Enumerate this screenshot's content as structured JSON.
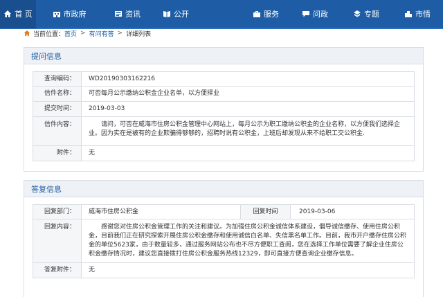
{
  "nav": {
    "items": [
      {
        "label": "首 页",
        "icon": "home-icon",
        "active": true
      },
      {
        "label": "市政府",
        "icon": "building-icon"
      },
      {
        "label": "资讯",
        "icon": "news-icon"
      },
      {
        "label": "公开",
        "icon": "book-icon"
      },
      {
        "label": "",
        "icon": "blank"
      },
      {
        "label": "服务",
        "icon": "service-icon"
      },
      {
        "label": "问政",
        "icon": "chat-icon"
      },
      {
        "label": "专题",
        "icon": "topic-icon"
      },
      {
        "label": "市情",
        "icon": "city-icon"
      }
    ]
  },
  "breadcrumb": {
    "prefix": "当前位置：",
    "items": [
      "首页",
      "有问有答",
      "详细列表"
    ],
    "sep": ">"
  },
  "question": {
    "title": "提问信息",
    "rows": [
      {
        "key": "查询编码：",
        "value": "WD20190303162216"
      },
      {
        "key": "信件名称：",
        "value": "可否每月公示缴纳公积金企业名单，以方便择业"
      },
      {
        "key": "提交时间：",
        "value": "2019-03-03"
      },
      {
        "key": "信件内容：",
        "value": "请问，可否在威海市住房公积金管理中心网站上，每月公示为职工缴纳公积金的企业名称，以方便我们选择企业。因为实在是被有的企业欺骗得够够的，招聘时说有公积金，上班后却发现从来不给职工交公积金."
      },
      {
        "key": "附件：",
        "value": "无"
      }
    ]
  },
  "answer": {
    "title": "答复信息",
    "dept_key": "回复部门：",
    "dept_value": "威海市住房公积金",
    "time_key": "回复时间",
    "time_value": "2019-03-06",
    "content_key": "回复内容：",
    "content_value": "感谢您对住房公积金管理工作的关注和建议。为加强住房公积金诚信体系建设，倡导诚信缴存、使用住房公积金，目前我们正在研究探索开展住房公积金缴存和使用诚信白名单、失信黑名单工作。目前，我市开户缴存住房公积金的单位5623家，由于数量较多，通过服务网站公布也不尽方便职工查阅，您在选择工作单位需要了解企业住房公积金缴存情况时，建议您直接拨打住房公积金服务热线12329，即可直接方便查询企业缴存信息。",
    "attach_key": "答复附件：",
    "attach_value": "无"
  },
  "colors": {
    "nav_bg": "#1e5da5",
    "accent": "#1e5da5",
    "header_bg": "#eef1f5",
    "border": "#d6dde6"
  }
}
